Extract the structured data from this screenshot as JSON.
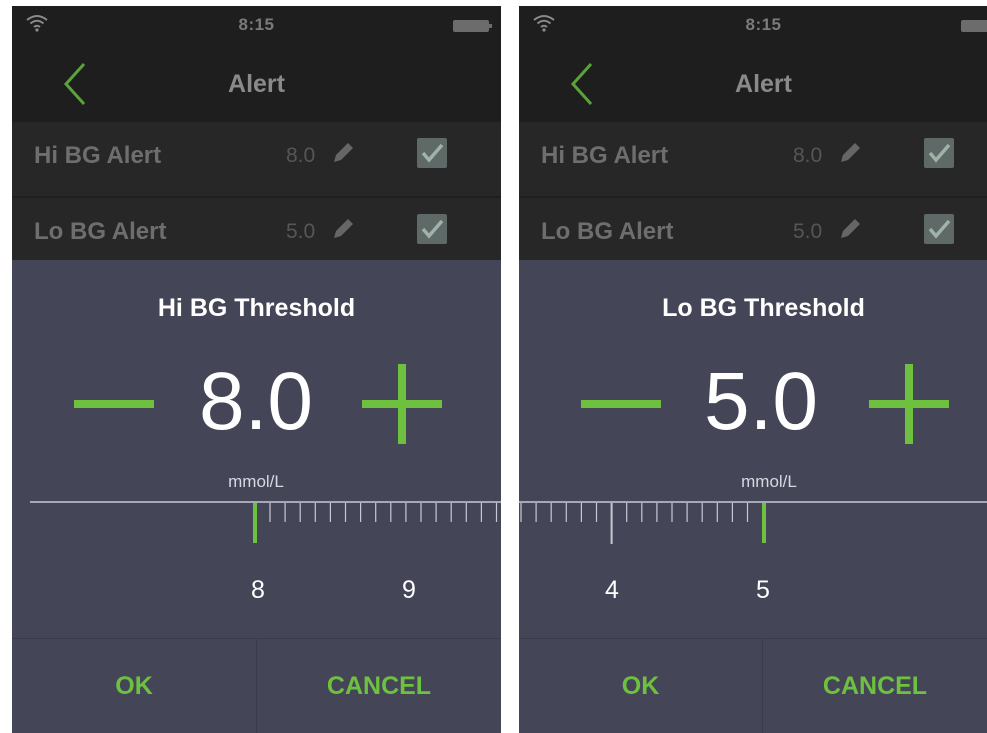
{
  "screens": [
    {
      "status": {
        "time": "8:15"
      },
      "header": {
        "title": "Alert"
      },
      "alerts": [
        {
          "label": "Hi BG Alert",
          "value": "8.0"
        },
        {
          "label": "Lo BG Alert",
          "value": "5.0"
        }
      ],
      "dialog": {
        "title": "Hi BG Threshold",
        "value": "8.0",
        "unit": "mmol/L",
        "ruler": {
          "tick_labels": [
            "8",
            "9"
          ],
          "selected": 8.0
        },
        "ok_label": "OK",
        "cancel_label": "CANCEL"
      }
    },
    {
      "status": {
        "time": "8:15"
      },
      "header": {
        "title": "Alert"
      },
      "alerts": [
        {
          "label": "Hi BG Alert",
          "value": "8.0"
        },
        {
          "label": "Lo BG Alert",
          "value": "5.0"
        }
      ],
      "dialog": {
        "title": "Lo BG Threshold",
        "value": "5.0",
        "unit": "mmol/L",
        "ruler": {
          "tick_labels": [
            "4",
            "5"
          ],
          "selected": 5.0
        },
        "ok_label": "OK",
        "cancel_label": "CANCEL"
      }
    }
  ],
  "colors": {
    "accent": "#6ec13f",
    "dialog_bg": "#454558",
    "background": "#1c1c1c"
  },
  "icons": [
    "wifi-icon",
    "battery-icon",
    "back-chevron-icon",
    "pencil-icon",
    "checkbox-checked-icon",
    "minus-icon",
    "plus-icon"
  ]
}
